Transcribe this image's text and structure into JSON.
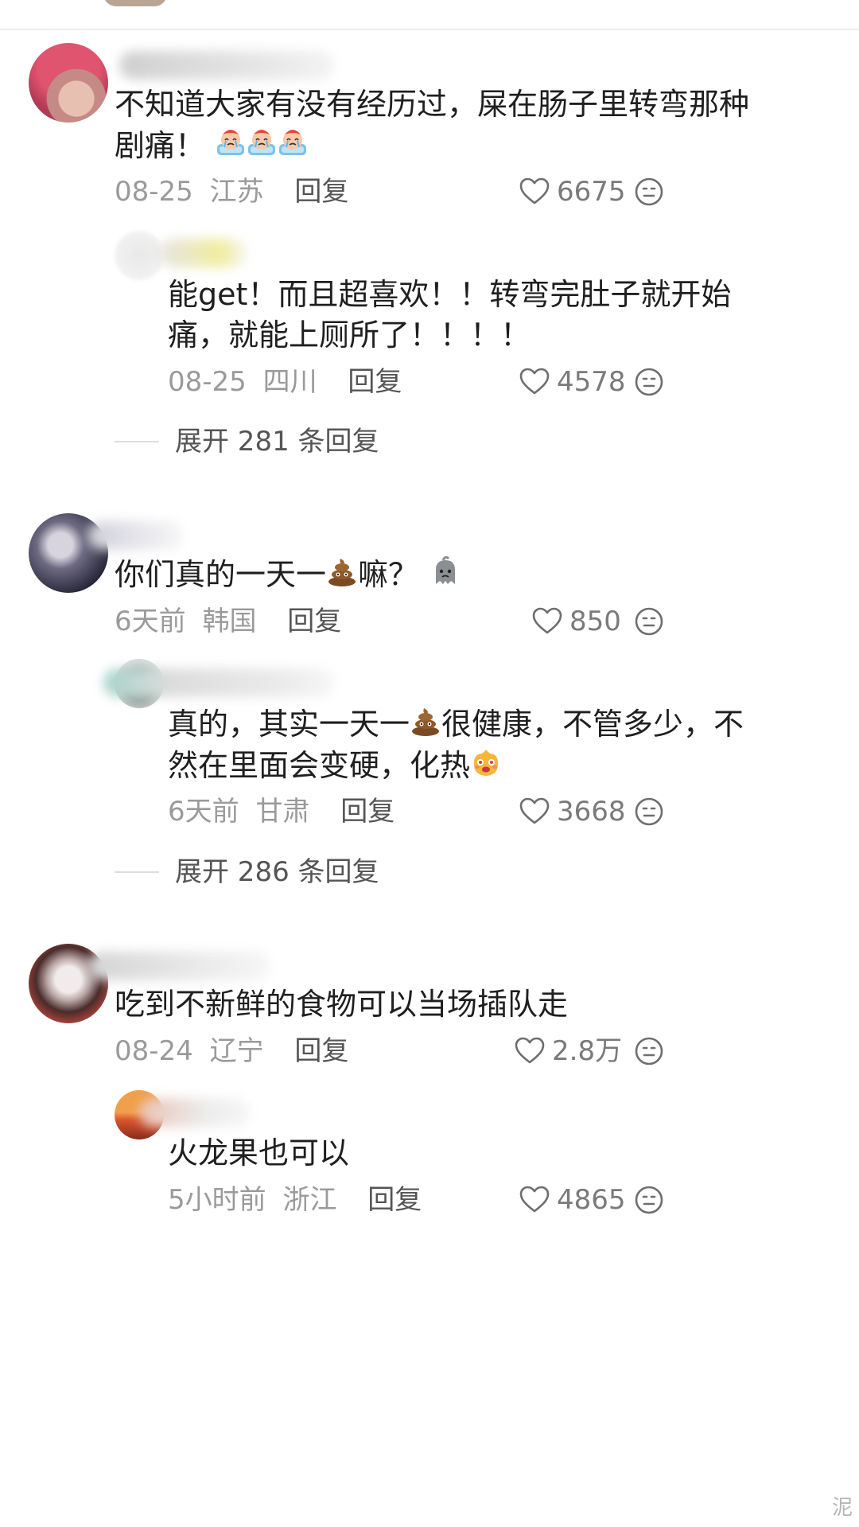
{
  "comments": [
    {
      "text_line1": "不知道大家有没有经历过，屎在肠子里转弯那种",
      "text_line2": "剧痛！",
      "emoji": "crying-face-emoji",
      "date": "08-25",
      "location": "江苏",
      "reply_label": "回复",
      "likes": "6675",
      "reply": {
        "text_line1": "能get！而且超喜欢！！转弯完肚子就开始",
        "text_line2": "痛，就能上厕所了！！！！",
        "date": "08-25",
        "location": "四川",
        "reply_label": "回复",
        "likes": "4578"
      },
      "expand_label": "展开 281 条回复"
    },
    {
      "text_before": "你们真的一天一",
      "text_after": "嘛？",
      "emoji": "poop-emoji",
      "emoji2": "ghost-emoji",
      "date": "6天前",
      "location": "韩国",
      "reply_label": "回复",
      "likes": "850",
      "reply": {
        "text_before": "真的，其实一天一",
        "text_after": "很健康，不管多少，不",
        "text_line2": "然在里面会变硬，化热",
        "date": "6天前",
        "location": "甘肃",
        "reply_label": "回复",
        "likes": "3668"
      },
      "expand_label": "展开 286 条回复"
    },
    {
      "text": "吃到不新鲜的食物可以当场插队走",
      "date": "08-24",
      "location": "辽宁",
      "reply_label": "回复",
      "likes": "2.8万",
      "reply": {
        "text": "火龙果也可以",
        "date": "5小时前",
        "location": "浙江",
        "reply_label": "回复",
        "likes": "4865"
      }
    }
  ],
  "watermark": "泥",
  "icons": {
    "like": "heart-outline-icon",
    "dislike": "neutral-face-icon"
  },
  "colors": {
    "meta": "#9a9a9a",
    "text": "#1f1f1f",
    "reply_link": "#555555"
  }
}
